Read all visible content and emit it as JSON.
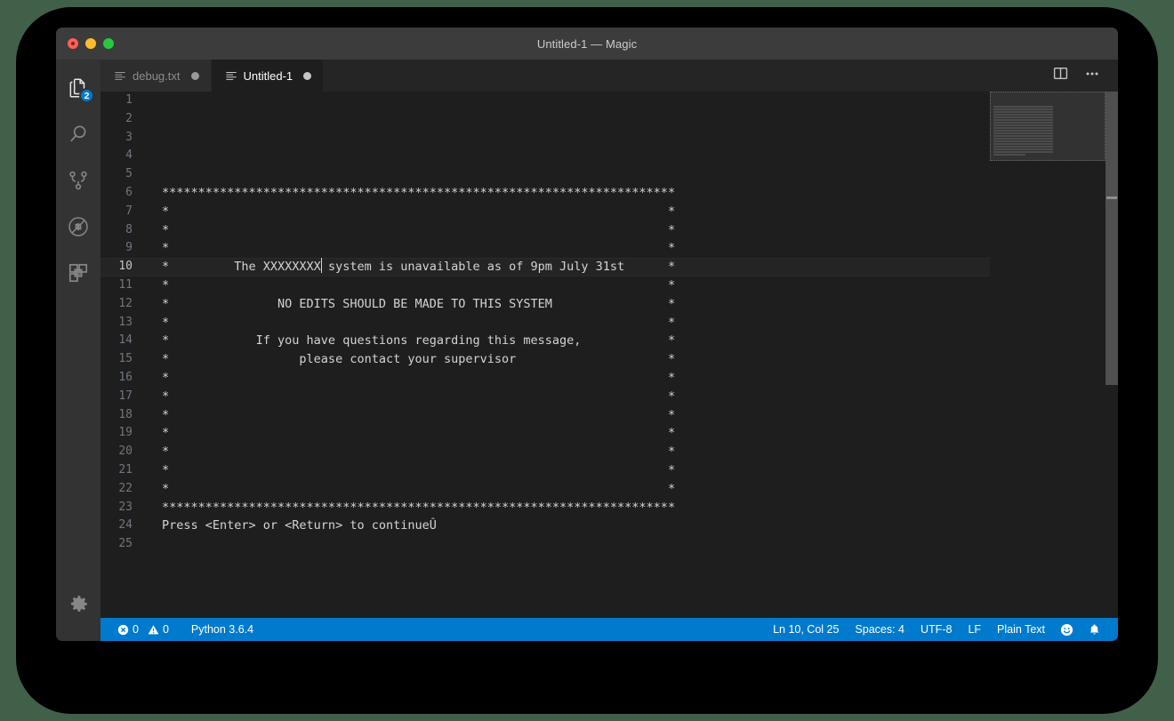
{
  "window": {
    "title": "Untitled-1 — Magic",
    "traffic_lights": [
      "close-button",
      "minimize-button",
      "maximize-button"
    ]
  },
  "activitybar": {
    "items": [
      {
        "name": "explorer",
        "icon": "files-icon",
        "badge": "2",
        "active": true
      },
      {
        "name": "search",
        "icon": "search-icon",
        "badge": "",
        "active": false
      },
      {
        "name": "source-control",
        "icon": "source-control-icon",
        "badge": "",
        "active": false
      },
      {
        "name": "run-and-debug",
        "icon": "debug-disabled-icon",
        "badge": "",
        "active": false
      },
      {
        "name": "extensions",
        "icon": "extensions-icon",
        "badge": "",
        "active": false
      }
    ],
    "bottom": {
      "name": "manage",
      "icon": "gear-icon"
    }
  },
  "tabs": [
    {
      "label": "debug.txt",
      "icon": "text-file-icon",
      "dirty": true,
      "active": false
    },
    {
      "label": "Untitled-1",
      "icon": "text-file-icon",
      "dirty": true,
      "active": true
    }
  ],
  "tab_actions": [
    {
      "name": "split-editor-button",
      "icon": "split-editor-icon"
    },
    {
      "name": "more-actions-button",
      "icon": "ellipsis-icon"
    }
  ],
  "editor": {
    "active_line": 10,
    "cursor_after_column": 25,
    "lines": [
      {
        "n": 1,
        "text": ""
      },
      {
        "n": 2,
        "text": ""
      },
      {
        "n": 3,
        "text": ""
      },
      {
        "n": 4,
        "text": ""
      },
      {
        "n": 5,
        "text": ""
      },
      {
        "n": 6,
        "text": "***********************************************************************"
      },
      {
        "n": 7,
        "text": "*                                                                     *"
      },
      {
        "n": 8,
        "text": "*                                                                     *"
      },
      {
        "n": 9,
        "text": "*                                                                     *"
      },
      {
        "n": 10,
        "text": "*         The XXXXXXXX| system is unavailable as of 9pm July 31st      *"
      },
      {
        "n": 11,
        "text": "*                                                                     *"
      },
      {
        "n": 12,
        "text": "*               NO EDITS SHOULD BE MADE TO THIS SYSTEM                *"
      },
      {
        "n": 13,
        "text": "*                                                                     *"
      },
      {
        "n": 14,
        "text": "*            If you have questions regarding this message,            *"
      },
      {
        "n": 15,
        "text": "*                  please contact your supervisor                     *"
      },
      {
        "n": 16,
        "text": "*                                                                     *"
      },
      {
        "n": 17,
        "text": "*                                                                     *"
      },
      {
        "n": 18,
        "text": "*                                                                     *"
      },
      {
        "n": 19,
        "text": "*                                                                     *"
      },
      {
        "n": 20,
        "text": "*                                                                     *"
      },
      {
        "n": 21,
        "text": "*                                                                     *"
      },
      {
        "n": 22,
        "text": "*                                                                     *"
      },
      {
        "n": 23,
        "text": "***********************************************************************"
      },
      {
        "n": 24,
        "text": "Press <Enter> or <Return> to continueÛ"
      },
      {
        "n": 25,
        "text": ""
      }
    ]
  },
  "minimap": {
    "present": true
  },
  "statusbar": {
    "errors": "0",
    "warnings": "0",
    "interpreter": "Python 3.6.4",
    "position": "Ln 10, Col 25",
    "indentation": "Spaces: 4",
    "encoding": "UTF-8",
    "eol": "LF",
    "language": "Plain Text",
    "feedback_icon": "smiley-icon",
    "notifications_icon": "bell-icon"
  },
  "colors": {
    "accent": "#007acc",
    "titlebar": "#3c3c3c",
    "activitybar": "#333333",
    "editor_bg": "#1e1e1e",
    "tab_inactive": "#2d2d2d",
    "desktop": "#41604a"
  }
}
